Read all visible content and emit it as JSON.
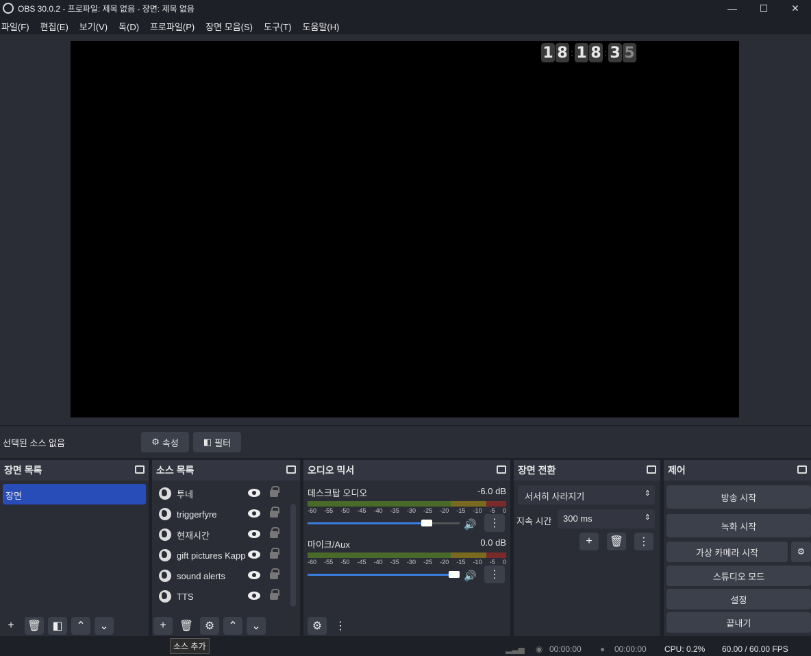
{
  "window": {
    "title": "OBS 30.0.2 - 프로파일: 제목 없음 - 장면: 제목 없음",
    "minimize": "—",
    "maximize": "☐",
    "close": "✕"
  },
  "menu": [
    "파일(F)",
    "편집(E)",
    "보기(V)",
    "독(D)",
    "프로파일(P)",
    "장면 모음(S)",
    "도구(T)",
    "도움말(H)"
  ],
  "clock": {
    "digits": [
      "1",
      "8",
      "1",
      "8",
      "3",
      "5"
    ]
  },
  "source_bar": {
    "no_source": "선택된 소스 없음",
    "properties": "속성",
    "filters": "필터"
  },
  "scenes": {
    "title": "장면 목록",
    "items": [
      "장면"
    ]
  },
  "sources": {
    "title": "소스 목록",
    "items": [
      "투네",
      "triggerfyre",
      "현재시간",
      "gift pictures Kapp",
      "sound alerts",
      "TTS"
    ]
  },
  "mixer": {
    "title": "오디오 믹서",
    "ticks": [
      "-60",
      "-55",
      "-50",
      "-45",
      "-40",
      "-35",
      "-30",
      "-25",
      "-20",
      "-15",
      "-10",
      "-5",
      "0"
    ],
    "channels": [
      {
        "name": "데스크탑 오디오",
        "db": "-6.0 dB",
        "level": 0.82
      },
      {
        "name": "마이크/Aux",
        "db": "0.0 dB",
        "level": 1.0
      }
    ]
  },
  "transitions": {
    "title": "장면 전환",
    "selected": "서서히 사라지기",
    "duration_label": "지속 시간",
    "duration": "300 ms"
  },
  "controls": {
    "title": "제어",
    "start_stream": "방송 시작",
    "start_record": "녹화 시작",
    "virtual_cam": "가상 카메라 시작",
    "studio_mode": "스튜디오 모드",
    "settings": "설정",
    "exit": "끝내기"
  },
  "tooltip": "소스 추가",
  "status": {
    "stream_time": "00:00:00",
    "record_time": "00:00:00",
    "cpu": "CPU: 0.2%",
    "fps": "60.00 / 60.00 FPS"
  }
}
